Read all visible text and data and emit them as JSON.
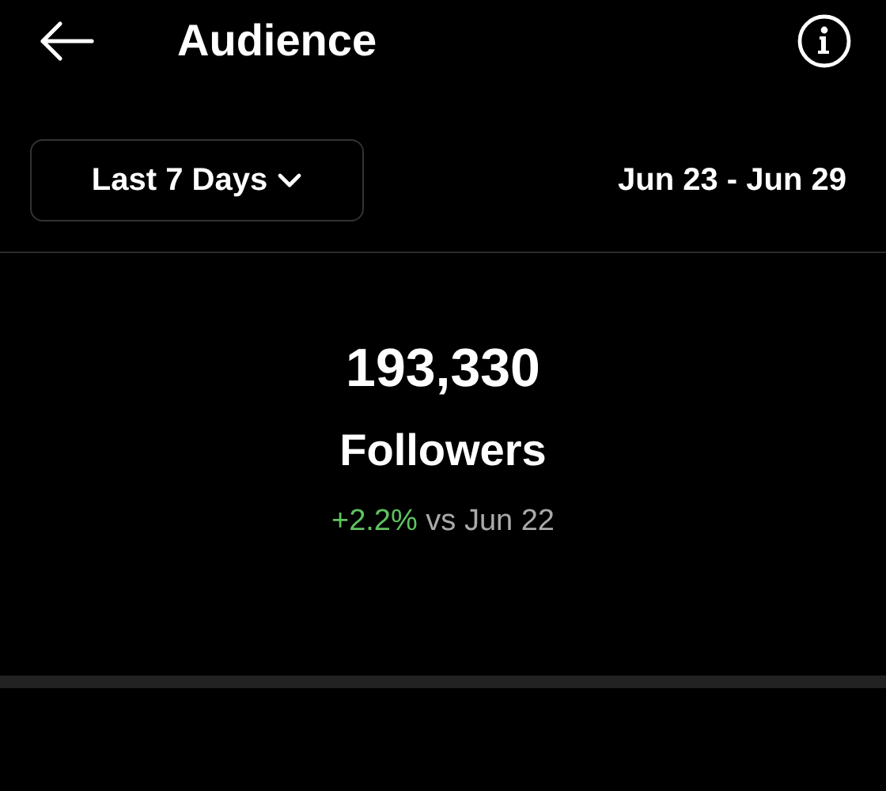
{
  "header": {
    "title": "Audience"
  },
  "range": {
    "label": "Last 7 Days",
    "dates": "Jun 23 - Jun 29"
  },
  "summary": {
    "value": "193,330",
    "label": "Followers",
    "change": "+2.2%",
    "positive": true,
    "comparison": "vs Jun 22"
  }
}
